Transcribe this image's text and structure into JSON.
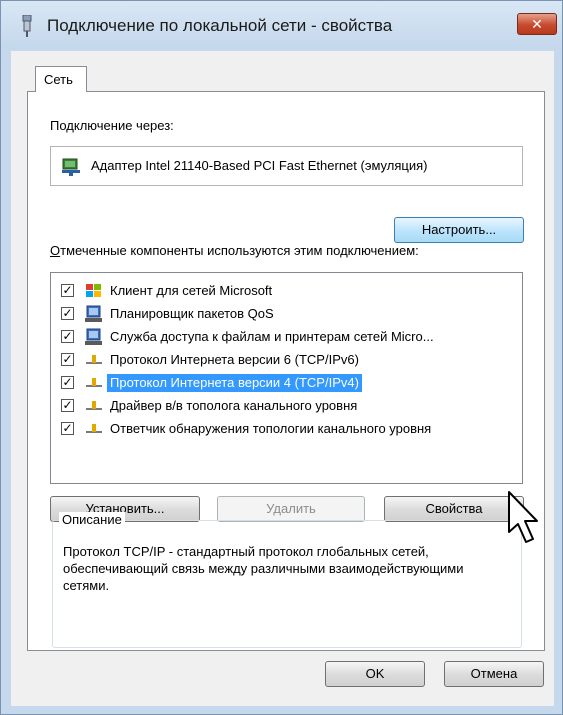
{
  "window": {
    "title": "Подключение по локальной сети - свойства",
    "close_label": "✕"
  },
  "tabs": [
    {
      "label": "Сеть"
    }
  ],
  "network": {
    "connect_using_label": "Подключение через:",
    "adapter_name": "Адаптер Intel 21140-Based PCI Fast Ethernet (эмуляция)",
    "configure_button": "Настроить...",
    "components_label": "Отмеченные компоненты используются этим подключением:",
    "components": [
      {
        "label": "Клиент для сетей Microsoft",
        "checked": true,
        "icon": "network-client-icon",
        "selected": false
      },
      {
        "label": "Планировщик пакетов QoS",
        "checked": true,
        "icon": "service-icon",
        "selected": false
      },
      {
        "label": "Служба доступа к файлам и принтерам сетей Micro...",
        "checked": true,
        "icon": "service-icon",
        "selected": false
      },
      {
        "label": "Протокол Интернета версии 6 (TCP/IPv6)",
        "checked": true,
        "icon": "protocol-icon",
        "selected": false
      },
      {
        "label": "Протокол Интернета версии 4 (TCP/IPv4)",
        "checked": true,
        "icon": "protocol-icon",
        "selected": true
      },
      {
        "label": "Драйвер в/в тополога канального уровня",
        "checked": true,
        "icon": "protocol-icon",
        "selected": false
      },
      {
        "label": "Ответчик обнаружения топологии канального уровня",
        "checked": true,
        "icon": "protocol-icon",
        "selected": false
      }
    ],
    "install_button": "Установить...",
    "uninstall_button": "Удалить",
    "properties_button": "Свойства",
    "description_legend": "Описание",
    "description_text": "Протокол TCP/IP - стандартный протокол глобальных сетей, обеспечивающий связь между различными взаимодействующими сетями."
  },
  "footer": {
    "ok_button": "OK",
    "cancel_button": "Отмена"
  },
  "colors": {
    "selection": "#3399ff",
    "titlebar": "#c4d7eb",
    "close_button": "#c64a2e"
  }
}
